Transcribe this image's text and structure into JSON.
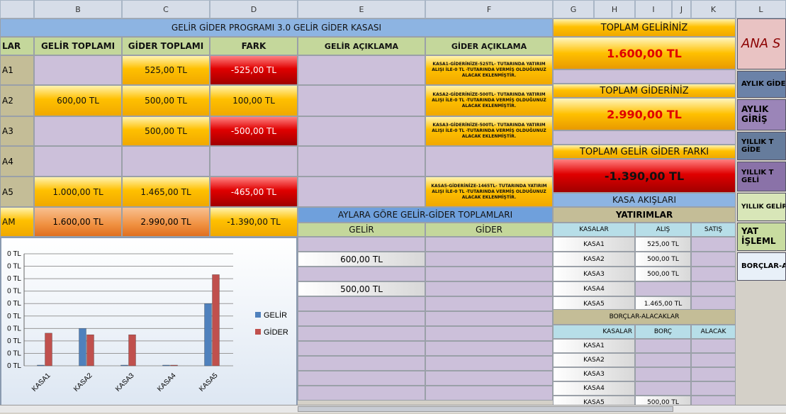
{
  "columns": [
    "B",
    "C",
    "D",
    "E",
    "F",
    "G",
    "H",
    "I",
    "J",
    "K",
    "L"
  ],
  "title": "GELİR GİDER PROGRAMI 3.0 GELİR GİDER KASASI",
  "headers": {
    "a": "LAR",
    "b": "GELİR TOPLAMI",
    "c": "GİDER TOPLAMI",
    "d": "FARK",
    "e": "GELİR AÇIKLAMA",
    "f": "GİDER AÇIKLAMA"
  },
  "rows": [
    {
      "a": "A1",
      "b": "",
      "c": "525,00 TL",
      "d": "-525,00 TL",
      "f": "KASA1-GİDERİNİZE-525TL- TUTARINDA YATIRIM ALIŞI İLE-0 TL -TUTARINDA VERMİŞ OLDUĞUNUZ ALACAK EKLENMİŞTİR."
    },
    {
      "a": "A2",
      "b": "600,00 TL",
      "c": "500,00 TL",
      "d": "100,00 TL",
      "f": "KASA2-GİDERİNİZE-500TL- TUTARINDA YATIRIM ALIŞI İLE-0 TL -TUTARINDA VERMİŞ OLDUĞUNUZ ALACAK EKLENMİŞTİR."
    },
    {
      "a": "A3",
      "b": "",
      "c": "500,00 TL",
      "d": "-500,00 TL",
      "f": "KASA3-GİDERİNİZE-500TL- TUTARINDA YATIRIM ALIŞI İLE-0 TL -TUTARINDA VERMİŞ OLDUĞUNUZ ALACAK EKLENMİŞTİR."
    },
    {
      "a": "A4",
      "b": "",
      "c": "",
      "d": "",
      "f": ""
    },
    {
      "a": "A5",
      "b": "1.000,00 TL",
      "c": "1.465,00 TL",
      "d": "-465,00 TL",
      "f": "KASA5-GİDERİNİZE-1465TL- TUTARINDA YATIRIM ALIŞI İLE-0 TL -TUTARINDA VERMİŞ OLDUĞUNUZ ALACAK EKLENMİŞTİR."
    }
  ],
  "total": {
    "a": "AM",
    "b": "1.600,00 TL",
    "c": "2.990,00 TL",
    "d": "-1.390,00 TL"
  },
  "summary": {
    "gelir_label": "TOPLAM GELİRİNİZ",
    "gelir_value": "1.600,00 TL",
    "gider_label": "TOPLAM GİDERİNİZ",
    "gider_value": "2.990,00 TL",
    "fark_label": "TOPLAM GELİR GİDER FARKI",
    "fark_value": "-1.390,00 TL"
  },
  "monthly": {
    "title": "AYLARA GÖRE GELİR-GİDER TOPLAMLARI",
    "gelir": "GELİR",
    "gider": "GİDER",
    "values": [
      "",
      "600,00 TL",
      "",
      "500,00 TL",
      "",
      "",
      "",
      "",
      "",
      "",
      ""
    ]
  },
  "kasa_akislari": "KASA AKIŞLARI",
  "yatirimlar": {
    "title": "YATIRIMLAR",
    "h1": "KASALAR",
    "h2": "ALIŞ",
    "h3": "SATIŞ",
    "rows": [
      {
        "k": "KASA1",
        "a": "525,00 TL"
      },
      {
        "k": "KASA2",
        "a": "500,00 TL"
      },
      {
        "k": "KASA3",
        "a": "500,00 TL"
      },
      {
        "k": "KASA4",
        "a": ""
      },
      {
        "k": "KASA5",
        "a": "1.465,00 TL"
      }
    ]
  },
  "borclar": {
    "title": "BORÇLAR-ALACAKLAR",
    "h1": "KASALAR",
    "h2": "BORÇ",
    "h3": "ALACAK",
    "rows": [
      {
        "k": "KASA1",
        "b": ""
      },
      {
        "k": "KASA2",
        "b": ""
      },
      {
        "k": "KASA3",
        "b": ""
      },
      {
        "k": "KASA4",
        "b": ""
      },
      {
        "k": "KASA5",
        "b": "500,00 TL"
      }
    ]
  },
  "buttons": [
    "ANA S",
    "AYLIK GİDER",
    "AYLIK\nGİRİŞ",
    "YILLIK T\nGİDE",
    "YILLIK T\nGELİ",
    "YILLIK GELİR-",
    "YAT\nİŞLEML",
    "BORÇLAR-A"
  ],
  "chart_data": {
    "type": "bar",
    "categories": [
      "KASA1",
      "KASA2",
      "KASA3",
      "KASA4",
      "KASA5"
    ],
    "series": [
      {
        "name": "GELİR",
        "values": [
          0,
          600,
          0,
          0,
          1000
        ],
        "color": "#4f81bd"
      },
      {
        "name": "GİDER",
        "values": [
          525,
          500,
          500,
          0,
          1465
        ],
        "color": "#c0504d"
      }
    ],
    "ytick_labels": [
      "0 TL",
      "0 TL",
      "0 TL",
      "0 TL",
      "0 TL",
      "0 TL",
      "0 TL",
      "0 TL",
      "0 TL",
      "0 TL"
    ],
    "ylim": [
      0,
      1800
    ],
    "legend": "right"
  }
}
